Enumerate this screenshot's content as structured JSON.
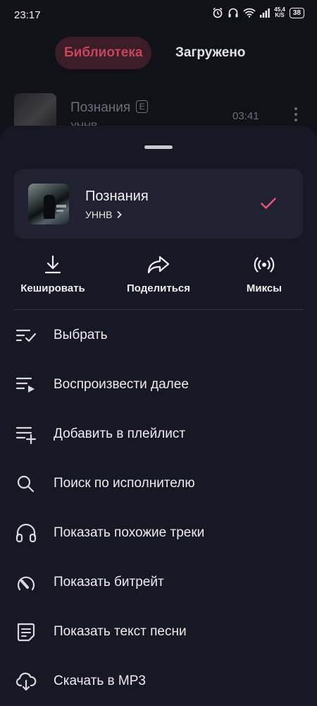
{
  "status_bar": {
    "time": "23:17",
    "net_speed_value": "45,4",
    "net_speed_unit": "K/S",
    "battery": "38"
  },
  "tabs": [
    {
      "label": "Библиотека",
      "active": true
    },
    {
      "label": "Загружено",
      "active": false
    }
  ],
  "background_track": {
    "title": "Познания",
    "explicit_badge": "E",
    "artist": "УННВ",
    "duration": "03:41"
  },
  "sheet": {
    "track": {
      "title": "Познания",
      "artist": "УННВ",
      "selected": true
    },
    "actions": [
      {
        "label": "Кешировать",
        "icon": "download-icon"
      },
      {
        "label": "Поделиться",
        "icon": "share-icon"
      },
      {
        "label": "Миксы",
        "icon": "broadcast-icon"
      }
    ],
    "menu": [
      {
        "label": "Выбрать",
        "icon": "select-list-icon"
      },
      {
        "label": "Воспроизвести далее",
        "icon": "play-next-icon"
      },
      {
        "label": "Добавить в плейлист",
        "icon": "add-to-playlist-icon"
      },
      {
        "label": "Поиск по исполнителю",
        "icon": "search-icon"
      },
      {
        "label": "Показать похожие треки",
        "icon": "headphones-icon"
      },
      {
        "label": "Показать битрейт",
        "icon": "gauge-icon"
      },
      {
        "label": "Показать текст песни",
        "icon": "lyrics-icon"
      },
      {
        "label": "Скачать в MP3",
        "icon": "cloud-download-icon"
      }
    ]
  },
  "colors": {
    "background": "#111119",
    "sheet": "#181824",
    "card": "#212131",
    "accent": "#e8587a",
    "tab_active_text": "#c5465a"
  }
}
